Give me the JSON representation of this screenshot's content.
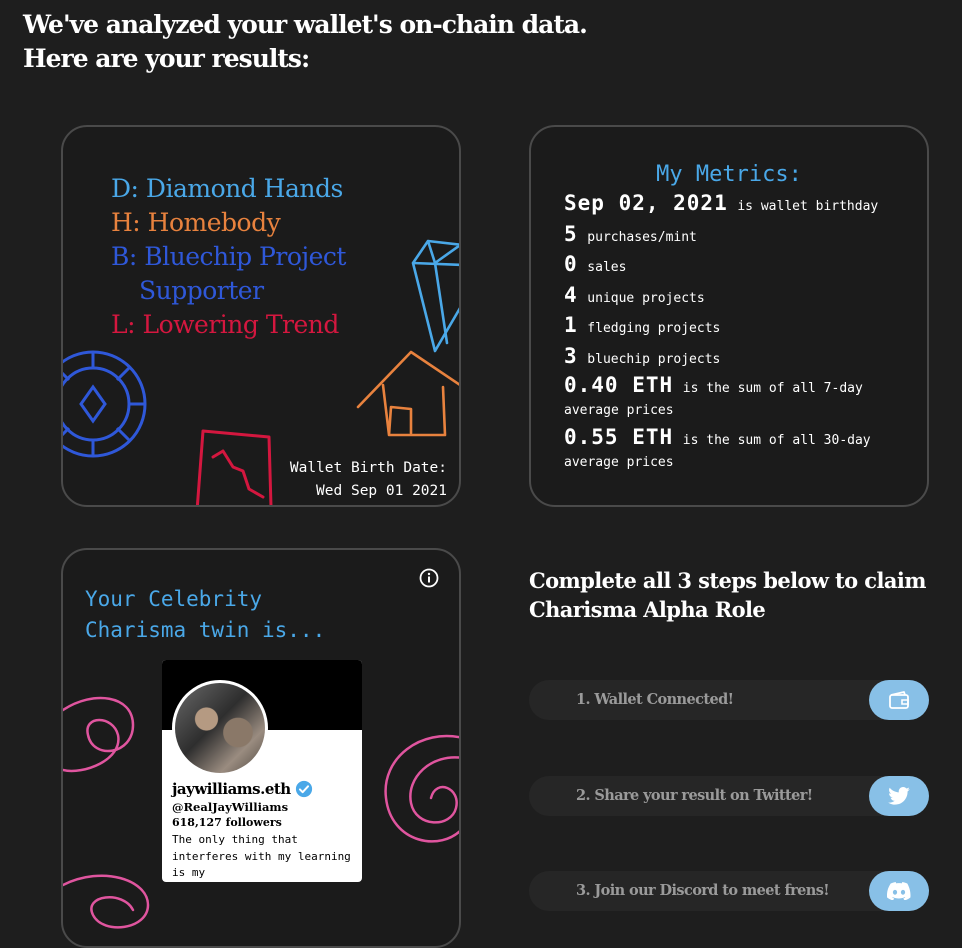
{
  "headline": {
    "line1": "We've analyzed your wallet's on-chain data.",
    "line2": "Here are your results:"
  },
  "dhbl_card": {
    "lines": [
      {
        "text": "D: Diamond Hands",
        "color": "#4aa8e8"
      },
      {
        "text": "H: Homebody",
        "color": "#e8823e"
      },
      {
        "text": "B: Bluechip Project",
        "color": "#2f58d9"
      },
      {
        "text": "Supporter",
        "color": "#2f58d9"
      },
      {
        "text": "L: Lowering Trend",
        "color": "#d4173f"
      }
    ],
    "birth_label": "Wallet Birth Date:",
    "birth_date": "Wed Sep 01 2021",
    "icons": [
      "diamond-icon",
      "house-icon",
      "chip-icon",
      "chart-icon"
    ]
  },
  "metrics": {
    "title": "My Metrics:",
    "rows": [
      {
        "value": "Sep 02, 2021",
        "text": "is wallet birthday"
      },
      {
        "value": "5",
        "text": "purchases/mint"
      },
      {
        "value": "0",
        "text": "sales"
      },
      {
        "value": "4",
        "text": "unique projects"
      },
      {
        "value": "1",
        "text": "fledging projects"
      },
      {
        "value": "3",
        "text": "bluechip projects"
      },
      {
        "value": "0.40 ETH",
        "text": "is the sum of all 7-day average prices"
      },
      {
        "value": "0.55 ETH",
        "text": "is the sum of all 30-day average prices"
      }
    ]
  },
  "twin": {
    "title_line1": "Your Celebrity",
    "title_line2": "Charisma twin is...",
    "info_icon": "info-icon",
    "profile": {
      "name": "jaywilliams.eth",
      "handle": "@RealJayWilliams",
      "followers": "618,127 followers",
      "bio": "The only thing that interferes with my learning is my"
    }
  },
  "steps": {
    "title_line1": "Complete all 3 steps below to claim",
    "title_line2": "Charisma Alpha Role",
    "items": [
      {
        "label": "1. Wallet Connected!",
        "icon": "wallet-icon"
      },
      {
        "label": "2. Share your result on Twitter!",
        "icon": "twitter-icon"
      },
      {
        "label": "3. Join our Discord to meet frens!",
        "icon": "discord-icon"
      }
    ],
    "button_color": "#88c0e7"
  }
}
